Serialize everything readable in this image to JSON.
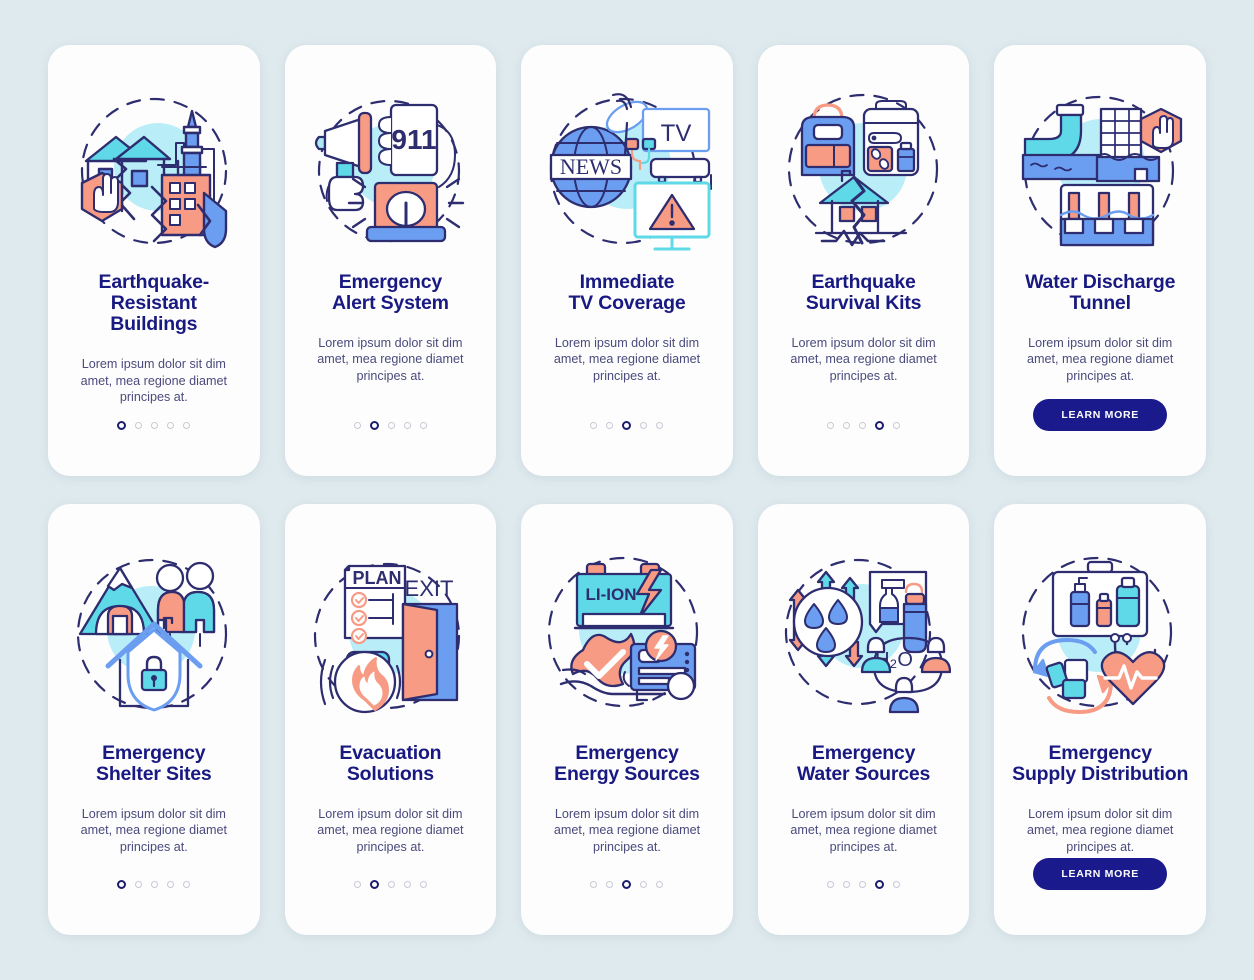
{
  "background_color": "#dfeaee",
  "card_color": "#fdfdfd",
  "palette": {
    "title_navy": "#191982",
    "body_text": "#4a4a7d",
    "button_navy": "#1a1a8c",
    "accent_coral": "#f79b85",
    "accent_blue": "#6b9ef0",
    "accent_cyan": "#5fd9e8",
    "accent_pale_cyan": "#aeeaf5",
    "outline_navy": "#2d2d70",
    "dot_inactive": "#c9c9d6"
  },
  "common": {
    "description": "Lorem ipsum dolor sit dim amet, mea regione diamet principes at.",
    "learn_more_label": "LEARN MORE"
  },
  "rows": [
    {
      "cards": [
        {
          "title_lines": [
            "Earthquake-Resistant",
            "Buildings"
          ],
          "description": "Lorem ipsum dolor sit dim amet, mea regione diamet principes at.",
          "illustration": "earthquake-resistant-buildings-icon",
          "footer": "dots",
          "dots_total": 5,
          "dots_active": 1
        },
        {
          "title_lines": [
            "Emergency",
            "Alert System"
          ],
          "description": "Lorem ipsum dolor sit dim amet, mea regione diamet principes at.",
          "illustration": "emergency-alert-system-icon",
          "illustration_labels": [
            "911"
          ],
          "footer": "dots",
          "dots_total": 5,
          "dots_active": 2
        },
        {
          "title_lines": [
            "Immediate",
            "TV Coverage"
          ],
          "description": "Lorem ipsum dolor sit dim amet, mea regione diamet principes at.",
          "illustration": "immediate-tv-coverage-icon",
          "illustration_labels": [
            "TV",
            "NEWS"
          ],
          "footer": "dots",
          "dots_total": 5,
          "dots_active": 3
        },
        {
          "title_lines": [
            "Earthquake",
            "Survival Kits"
          ],
          "description": "Lorem ipsum dolor sit dim amet, mea regione diamet principes at.",
          "illustration": "earthquake-survival-kits-icon",
          "footer": "dots",
          "dots_total": 5,
          "dots_active": 4
        },
        {
          "title_lines": [
            "Water Discharge",
            "Tunnel"
          ],
          "description": "Lorem ipsum dolor sit dim amet, mea regione diamet principes at.",
          "illustration": "water-discharge-tunnel-icon",
          "footer": "button",
          "button_label": "LEARN MORE"
        }
      ]
    },
    {
      "cards": [
        {
          "title_lines": [
            "Emergency",
            "Shelter Sites"
          ],
          "description": "Lorem ipsum dolor sit dim amet, mea regione diamet principes at.",
          "illustration": "emergency-shelter-sites-icon",
          "footer": "dots",
          "dots_total": 5,
          "dots_active": 1
        },
        {
          "title_lines": [
            "Evacuation",
            "Solutions"
          ],
          "description": "Lorem ipsum dolor sit dim amet, mea regione diamet principes at.",
          "illustration": "evacuation-solutions-icon",
          "illustration_labels": [
            "PLAN",
            "EXIT"
          ],
          "footer": "dots",
          "dots_total": 5,
          "dots_active": 2
        },
        {
          "title_lines": [
            "Emergency",
            "Energy Sources"
          ],
          "description": "Lorem ipsum dolor sit dim amet, mea regione diamet principes at.",
          "illustration": "emergency-energy-sources-icon",
          "illustration_labels": [
            "LI-ION"
          ],
          "footer": "dots",
          "dots_total": 5,
          "dots_active": 3
        },
        {
          "title_lines": [
            "Emergency",
            "Water Sources"
          ],
          "description": "Lorem ipsum dolor sit dim amet, mea regione diamet principes at.",
          "illustration": "emergency-water-sources-icon",
          "illustration_labels": [
            "H2O"
          ],
          "footer": "dots",
          "dots_total": 5,
          "dots_active": 4
        },
        {
          "title_lines": [
            "Emergency",
            "Supply Distribution"
          ],
          "description": "Lorem ipsum dolor sit dim amet, mea regione diamet principes at.",
          "illustration": "emergency-supply-distribution-icon",
          "footer": "button",
          "button_label": "LEARN MORE"
        }
      ]
    }
  ]
}
